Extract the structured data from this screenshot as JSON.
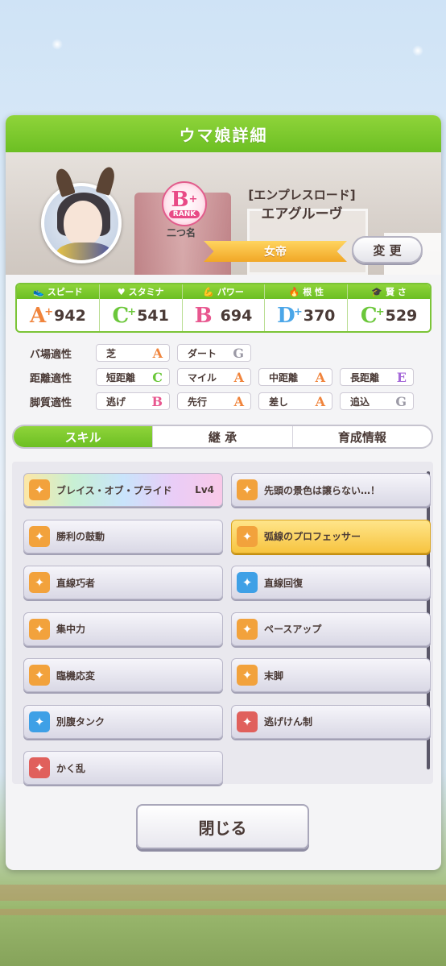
{
  "header": {
    "title": "ウマ娘詳細"
  },
  "profile": {
    "rank_letter": "B",
    "rank_plus": "+",
    "rank_word": "RANK",
    "nickname": "二つ名",
    "outfit": "[エンプレスロード]",
    "name": "エアグルーヴ",
    "title": "女帝",
    "change_label": "変 更"
  },
  "stats": [
    {
      "label": "スピード",
      "icon": "shoe-icon",
      "grade": "A",
      "plus": "+",
      "value": "942",
      "color": "#f0843c"
    },
    {
      "label": "スタミナ",
      "icon": "heart-icon",
      "grade": "C",
      "plus": "+",
      "value": "541",
      "color": "#6bc73a"
    },
    {
      "label": "パワー",
      "icon": "muscle-icon",
      "grade": "B",
      "plus": "",
      "value": "694",
      "color": "#e8578f"
    },
    {
      "label": "根 性",
      "icon": "flame-icon",
      "grade": "D",
      "plus": "+",
      "value": "370",
      "color": "#4ba6e8"
    },
    {
      "label": "賢 さ",
      "icon": "mortarboard-icon",
      "grade": "C",
      "plus": "+",
      "value": "529",
      "color": "#6bc73a"
    }
  ],
  "aptitudes": {
    "track": {
      "label": "バ場適性",
      "items": [
        {
          "name": "芝",
          "grade": "A"
        },
        {
          "name": "ダート",
          "grade": "G"
        }
      ]
    },
    "distance": {
      "label": "距離適性",
      "items": [
        {
          "name": "短距離",
          "grade": "C"
        },
        {
          "name": "マイル",
          "grade": "A"
        },
        {
          "name": "中距離",
          "grade": "A"
        },
        {
          "name": "長距離",
          "grade": "E"
        }
      ]
    },
    "style": {
      "label": "脚質適性",
      "items": [
        {
          "name": "逃げ",
          "grade": "B"
        },
        {
          "name": "先行",
          "grade": "A"
        },
        {
          "name": "差し",
          "grade": "A"
        },
        {
          "name": "追込",
          "grade": "G"
        }
      ]
    },
    "grade_colors": {
      "A": "#f0843c",
      "B": "#e8578f",
      "C": "#6bc73a",
      "E": "#a66ad9",
      "G": "#9c9aa6"
    }
  },
  "tabs": [
    "スキル",
    "継 承",
    "育成情報"
  ],
  "skills": [
    {
      "name": "ブレイス・オブ・プライド",
      "lv": "Lv4",
      "style": "rainbow",
      "icon_color": "#f2a23c"
    },
    {
      "name": "先頭の景色は譲らない…！",
      "lv": "",
      "style": "normal",
      "icon_color": "#f2a23c"
    },
    {
      "name": "勝利の鼓動",
      "lv": "",
      "style": "normal",
      "icon_color": "#f2a23c"
    },
    {
      "name": "弧線のプロフェッサー",
      "lv": "",
      "style": "gold",
      "icon_color": "#f2a23c"
    },
    {
      "name": "直線巧者",
      "lv": "",
      "style": "normal",
      "icon_color": "#f2a23c"
    },
    {
      "name": "直線回復",
      "lv": "",
      "style": "normal",
      "icon_color": "#3ea0e6"
    },
    {
      "name": "集中力",
      "lv": "",
      "style": "normal",
      "icon_color": "#f2a23c"
    },
    {
      "name": "ペースアップ",
      "lv": "",
      "style": "normal",
      "icon_color": "#f2a23c"
    },
    {
      "name": "臨機応変",
      "lv": "",
      "style": "normal",
      "icon_color": "#f2a23c"
    },
    {
      "name": "末脚",
      "lv": "",
      "style": "normal",
      "icon_color": "#f2a23c"
    },
    {
      "name": "別腹タンク",
      "lv": "",
      "style": "normal",
      "icon_color": "#3ea0e6"
    },
    {
      "name": "逃げけん制",
      "lv": "",
      "style": "normal",
      "icon_color": "#e0605c"
    },
    {
      "name": "かく乱",
      "lv": "",
      "style": "normal",
      "icon_color": "#e0605c"
    }
  ],
  "close_label": "閉じる"
}
